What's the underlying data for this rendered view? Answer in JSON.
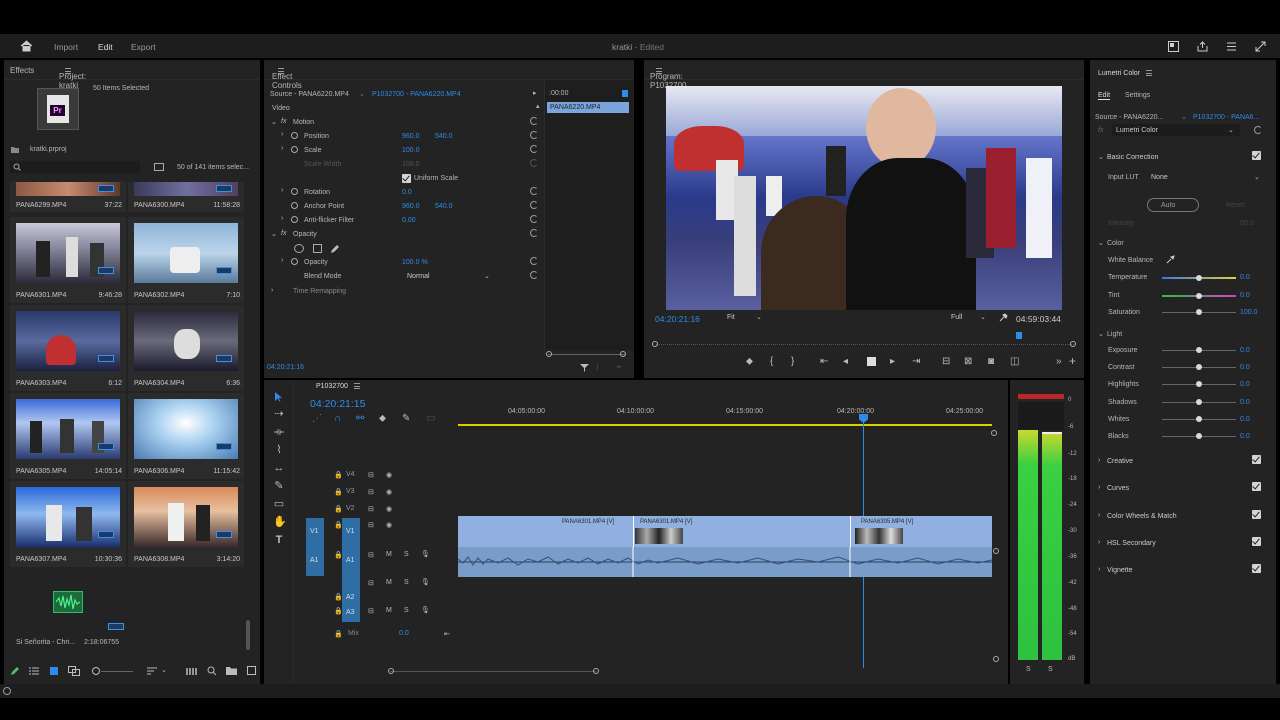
{
  "app": {
    "nav": [
      "Import",
      "Edit",
      "Export"
    ],
    "active_nav": "Edit",
    "title": "kratki",
    "title_status": "- Edited"
  },
  "project": {
    "tab_effects": "Effects",
    "tab_project": "Project: kratki",
    "selected_info": "50 Items Selected",
    "file_name": "kratki.prproj",
    "count": "50 of 141 items selec...",
    "top_row": [
      {
        "name": "PANA6299.MP4",
        "duration": "37:22"
      },
      {
        "name": "PANA6300.MP4",
        "duration": "11:58:28"
      }
    ],
    "items": [
      {
        "name": "PANA6301.MP4",
        "duration": "9:46:28"
      },
      {
        "name": "PANA6302.MP4",
        "duration": "7:10"
      },
      {
        "name": "PANA6303.MP4",
        "duration": "6:12"
      },
      {
        "name": "PANA6304.MP4",
        "duration": "6:36"
      },
      {
        "name": "PANA6305.MP4",
        "duration": "14:05:14"
      },
      {
        "name": "PANA6306.MP4",
        "duration": "11:15:42"
      },
      {
        "name": "PANA6307.MP4",
        "duration": "10:30:36"
      },
      {
        "name": "PANA6308.MP4",
        "duration": "3:14:20"
      }
    ],
    "audio_item": {
      "name": "Si Señorita - Chri...",
      "duration": "2:18:06755"
    }
  },
  "effect_controls": {
    "tab": "Effect Controls",
    "source_label": "Source - PANA6220.MP4",
    "target_label": "P1032700 - PANA6220.MP4",
    "timecode_start": ":00:00",
    "clip_bar": "PANA6220.MP4",
    "section_video": "Video",
    "motion": "Motion",
    "position": {
      "label": "Position",
      "x": "960.0",
      "y": "540.0"
    },
    "scale": {
      "label": "Scale",
      "value": "100.0"
    },
    "scale_width": {
      "label": "Scale Width",
      "value": "100.0"
    },
    "uniform_scale": "Uniform Scale",
    "rotation": {
      "label": "Rotation",
      "value": "0.0"
    },
    "anchor": {
      "label": "Anchor Point",
      "x": "960.0",
      "y": "540.0"
    },
    "antiflicker": {
      "label": "Anti-flicker Filter",
      "value": "0.00"
    },
    "opacity_section": "Opacity",
    "opacity": {
      "label": "Opacity",
      "value": "100.0 %"
    },
    "blend": {
      "label": "Blend Mode",
      "value": "Normal"
    },
    "time_remap": "Time Remapping",
    "footer_timecode": "04:20:21:16"
  },
  "program": {
    "tab": "Program: P1032700",
    "timecode": "04:20:21:16",
    "fit": "Fit",
    "quality": "Full",
    "duration": "04:59:03:44"
  },
  "timeline": {
    "tab": "P1032700",
    "timecode": "04:20:21:15",
    "ruler": [
      "04:05:00:00",
      "04:10:00:00",
      "04:15:00:00",
      "04:20:00:00",
      "04:25:00:00"
    ],
    "tracks": [
      "V4",
      "V3",
      "V2",
      "V1",
      "A1",
      "A2",
      "A3"
    ],
    "mix_label": "Mix",
    "mix_value": "0.0",
    "clips": [
      "PANA6301.MP4 [V]",
      "PANA6301.MP4 [V]",
      "PANA6305.MP4 [V]"
    ],
    "meter_labels": [
      "0",
      "-6",
      "-12",
      "-18",
      "-24",
      "-30",
      "-36",
      "-42",
      "-48",
      "-54",
      "dB"
    ],
    "meter_bottom": [
      "S",
      "S"
    ]
  },
  "lumetri": {
    "title": "Lumetri Color",
    "tab_edit": "Edit",
    "tab_settings": "Settings",
    "source": "Source - PANA6220...",
    "target": "P1032700 - PANA6...",
    "effect": "Lumetri Color",
    "basic": "Basic Correction",
    "input_lut_label": "Input LUT",
    "input_lut": "None",
    "auto": "Auto",
    "reset": "Reset",
    "intensity": "Intensity",
    "intensity_value": "50.0",
    "color": "Color",
    "white_balance": "White Balance",
    "temperature": {
      "label": "Temperature",
      "value": "0.0"
    },
    "tint": {
      "label": "Tint",
      "value": "0.0"
    },
    "saturation": {
      "label": "Saturation",
      "value": "100.0"
    },
    "light": "Light",
    "exposure": {
      "label": "Exposure",
      "value": "0.0"
    },
    "contrast": {
      "label": "Contrast",
      "value": "0.0"
    },
    "highlights": {
      "label": "Highlights",
      "value": "0.0"
    },
    "shadows": {
      "label": "Shadows",
      "value": "0.0"
    },
    "whites": {
      "label": "Whites",
      "value": "0.0"
    },
    "blacks": {
      "label": "Blacks",
      "value": "0.0"
    },
    "sections": [
      "Creative",
      "Curves",
      "Color Wheels & Match",
      "HSL Secondary",
      "Vignette"
    ]
  },
  "colors": {
    "accent": "#2d8ceb",
    "panel": "#232323",
    "clip": "#8fb0e0",
    "track_active": "#2f6ea5"
  }
}
